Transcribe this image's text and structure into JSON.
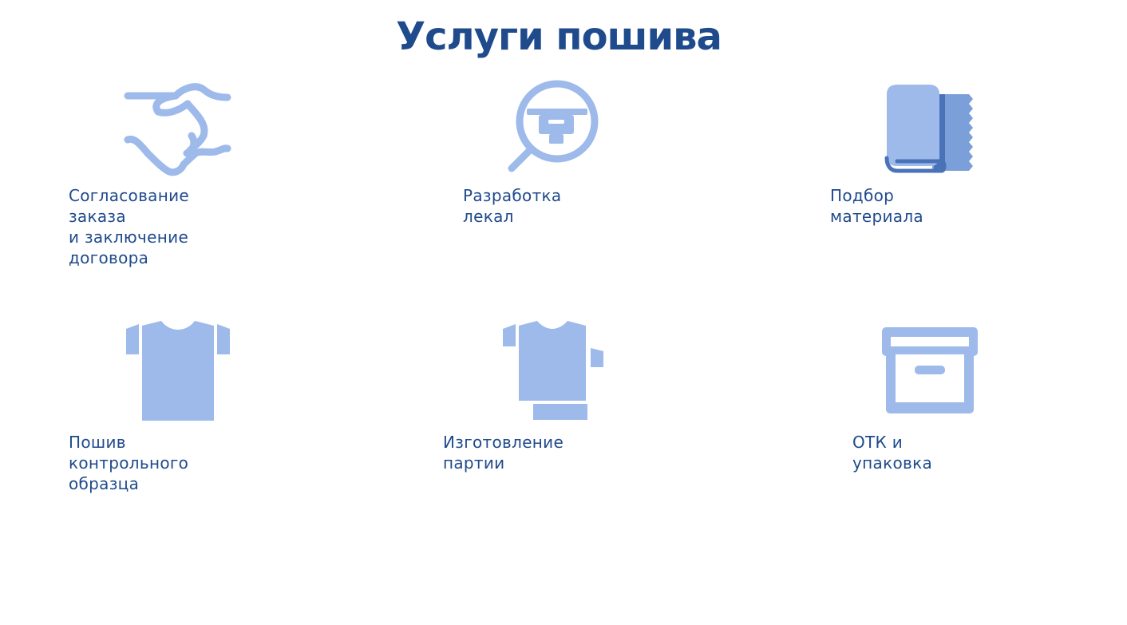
{
  "title": "Услуги пошива",
  "colors": {
    "title": "#1f4a8c",
    "label": "#1f4a8c",
    "icon_light": "#9dbaea",
    "icon_mid": "#7b9fd8",
    "icon_dark": "#4a72b8"
  },
  "services": [
    {
      "label": "Согласование заказа\nи заключение договора",
      "icon": "handshake-icon"
    },
    {
      "label": "Разработка лекал",
      "icon": "magnifier-sewing-machine-icon"
    },
    {
      "label": "Подбор материала",
      "icon": "fabric-roll-icon"
    },
    {
      "label": "Пошив контрольного\nобразца",
      "icon": "tshirt-icon"
    },
    {
      "label": "Изготовление партии",
      "icon": "tshirt-stack-icon"
    },
    {
      "label": "ОТК и упаковка",
      "icon": "box-icon"
    }
  ]
}
